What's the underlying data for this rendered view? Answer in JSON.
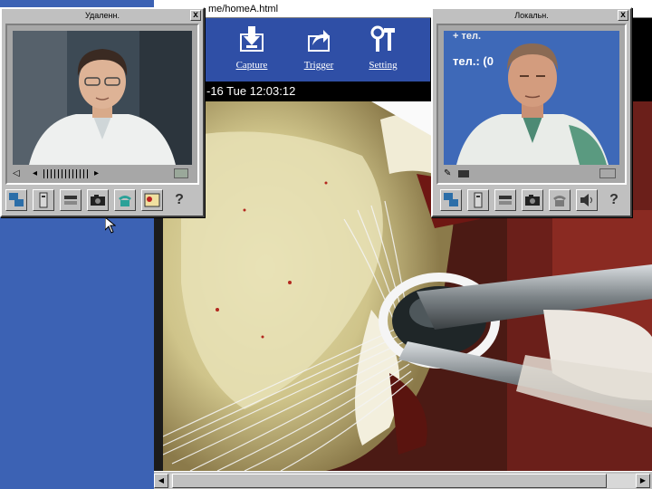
{
  "browser": {
    "url": "me/homeA.html",
    "datetime": "-16 Tue  12:03:12",
    "toolbar": [
      {
        "label": "Capture",
        "icon": "download-icon"
      },
      {
        "label": "Trigger",
        "icon": "share-arrow-icon"
      },
      {
        "label": "Setting",
        "icon": "tools-icon"
      }
    ]
  },
  "remote_window": {
    "title": "Удаленн.",
    "close_label": "x",
    "icons": [
      "network-icon",
      "phone-keypad-icon",
      "dial-icon",
      "camera-icon",
      "telephone-icon",
      "contact-card-icon",
      "help-icon"
    ]
  },
  "local_window": {
    "title": "Локальн.",
    "close_label": "x",
    "poster_text": [
      "тел.: (0",
      "+ тел."
    ],
    "icons": [
      "network-icon",
      "phone-keypad-icon",
      "dial-icon",
      "camera-icon",
      "telephone-icon",
      "speaker-icon",
      "help-icon"
    ]
  },
  "colors": {
    "desktop": "#3c62b4",
    "toolbar": "#2f4fa6",
    "window": "#c0c0c0"
  }
}
